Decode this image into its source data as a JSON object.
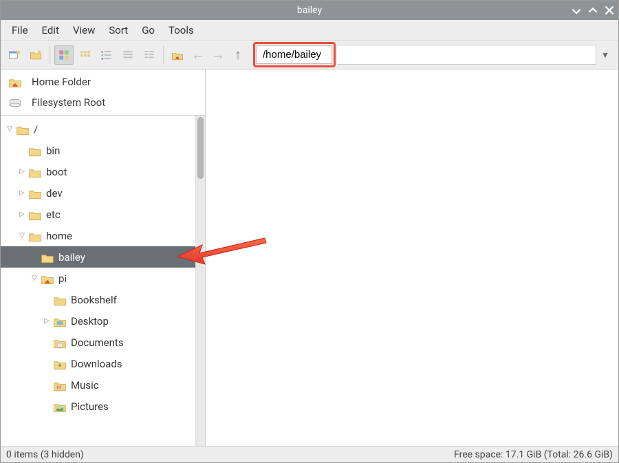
{
  "window": {
    "title": "bailey"
  },
  "menu": {
    "file": "File",
    "edit": "Edit",
    "view": "View",
    "sort": "Sort",
    "go": "Go",
    "tools": "Tools"
  },
  "path": {
    "value": "/home/bailey"
  },
  "places": {
    "home_folder": "Home Folder",
    "filesystem_root": "Filesystem Root"
  },
  "tree": {
    "root": "/",
    "bin": "bin",
    "boot": "boot",
    "dev": "dev",
    "etc": "etc",
    "home": "home",
    "bailey": "bailey",
    "pi": "pi",
    "bookshelf": "Bookshelf",
    "desktop": "Desktop",
    "documents": "Documents",
    "downloads": "Downloads",
    "music": "Music",
    "pictures": "Pictures"
  },
  "status": {
    "left": "0 items (3 hidden)",
    "right": "Free space: 17.1 GiB (Total: 26.6 GiB)"
  }
}
